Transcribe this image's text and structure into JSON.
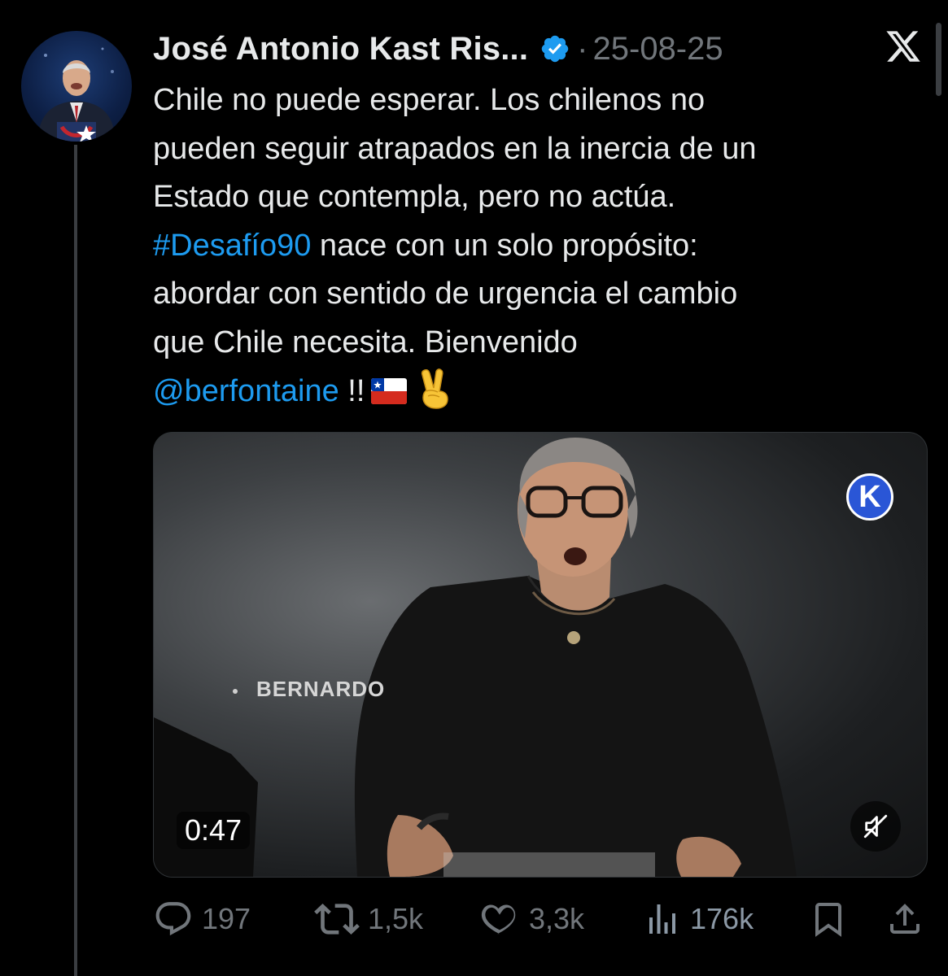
{
  "tweet": {
    "author_name": "José Antonio Kast Ris...",
    "separator": "·",
    "date": "25-08-25",
    "text_lines": [
      "Chile no puede esperar. Los chilenos no",
      "pueden seguir atrapados en la inercia de un",
      "Estado que contempla, pero no actúa."
    ],
    "hashtag": "#Desafío90",
    "line4_rest": " nace con un solo propósito:",
    "line5": "abordar con sentido de urgencia el cambio",
    "line6": "que Chile necesita. Bienvenido",
    "mention": "@berfontaine",
    "mention_suffix": " !!"
  },
  "media": {
    "overlay_name": "BERNARDO",
    "duration": "0:47",
    "badge_letter": "K"
  },
  "actions": {
    "replies": "197",
    "reposts": "1,5k",
    "likes": "3,3k",
    "views": "176k"
  },
  "colors": {
    "background": "#000000",
    "text": "#e7e9ea",
    "muted": "#71767b",
    "link": "#1d9bf0",
    "verified": "#1d9bf0"
  },
  "icons": [
    "verified-badge-icon",
    "x-logo-icon",
    "chile-flag-icon",
    "victory-hand-icon",
    "mute-icon",
    "reply-icon",
    "repost-icon",
    "like-icon",
    "views-icon",
    "bookmark-icon",
    "share-icon"
  ]
}
